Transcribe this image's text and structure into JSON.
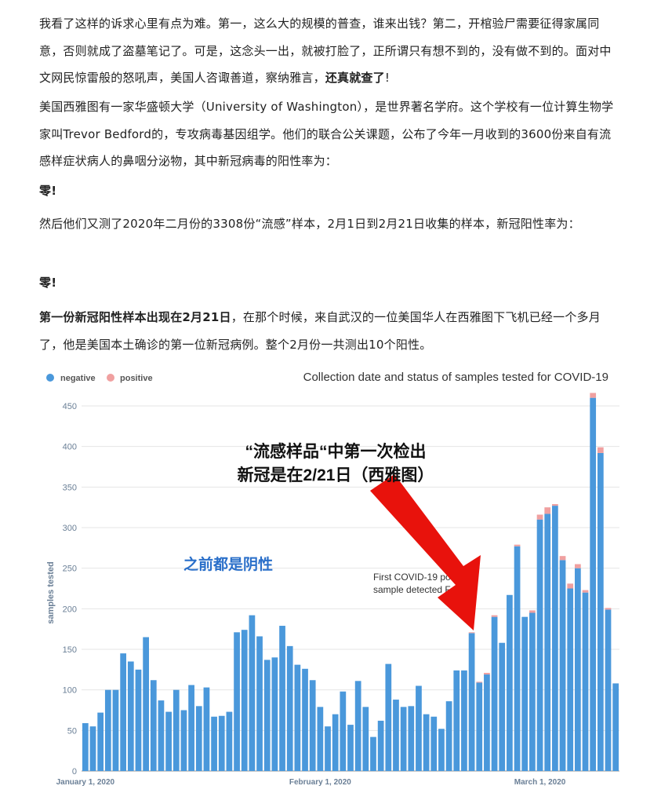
{
  "article": {
    "p1": "我看了这样的诉求心里有点为难。第一，这么大的规模的普查，谁来出钱？第二，开棺验尸需要征得家属同意，否则就成了盗墓笔记了。可是，这念头一出，就被打脸了，正所谓只有想不到的，没有做不到的。面对中文网民惊雷般的怒吼声，美国人咨诹善道，察纳雅言，",
    "p1_bold": "还真就查了",
    "p1_end": "!",
    "p2": "美国西雅图有一家华盛顿大学（University of Washington），是世界著名学府。这个学校有一位计算生物学家叫Trevor Bedford的，专攻病毒基因组学。他们的联合公关课题，公布了今年一月收到的3600份来自有流感样症状病人的鼻咽分泌物，其中新冠病毒的阳性率为：",
    "p3": "零!",
    "p4": "然后他们又测了2020年二月份的3308份“流感”样本，2月1日到2月21日收集的样本，新冠阳性率为：",
    "p5": "零!",
    "p6_bold": "第一份新冠阳性样本出现在2月21日",
    "p6": "，在那个时候，来自武汉的一位美国华人在西雅图下飞机已经一个多月了，他是美国本土确诊的第一位新冠病例。整个2月份一共测出10个阳性。"
  },
  "chart_data": {
    "type": "bar",
    "stacked": true,
    "title": "Collection date and status of samples tested for COVID-19",
    "ylabel": "samples tested",
    "xlabel": "",
    "ylim": [
      0,
      475
    ],
    "yticks": [
      0,
      50,
      100,
      150,
      200,
      250,
      300,
      350,
      400,
      450
    ],
    "grid": true,
    "legend": {
      "placement": "top-left",
      "items": [
        "negative",
        "positive"
      ]
    },
    "colors": {
      "negative": "#4a98db",
      "positive": "#f0a0a0",
      "annotation": "#2a6fc9",
      "arrow": "#e8120c"
    },
    "x_labels": [
      {
        "label": "January 1, 2020",
        "index": 0
      },
      {
        "label": "February 1, 2020",
        "index": 31
      },
      {
        "label": "March 1, 2020",
        "index": 60
      }
    ],
    "series": [
      {
        "name": "negative",
        "values": [
          59,
          55,
          72,
          100,
          100,
          145,
          135,
          125,
          165,
          112,
          87,
          73,
          100,
          75,
          106,
          80,
          103,
          67,
          68,
          73,
          171,
          174,
          192,
          166,
          137,
          140,
          179,
          154,
          131,
          126,
          112,
          79,
          55,
          70,
          98,
          57,
          111,
          79,
          42,
          62,
          132,
          88,
          79,
          80,
          105,
          70,
          67,
          52,
          86,
          124,
          124,
          170,
          109,
          119,
          190,
          158,
          217,
          277,
          190,
          195,
          310,
          317,
          327,
          260,
          225,
          250,
          220,
          460,
          392,
          199,
          108
        ]
      },
      {
        "name": "positive",
        "values": [
          0,
          0,
          0,
          0,
          0,
          0,
          0,
          0,
          0,
          0,
          0,
          0,
          0,
          0,
          0,
          0,
          0,
          0,
          0,
          0,
          0,
          0,
          0,
          0,
          0,
          0,
          0,
          0,
          0,
          0,
          0,
          0,
          0,
          0,
          0,
          0,
          0,
          0,
          0,
          0,
          0,
          0,
          0,
          0,
          0,
          0,
          0,
          0,
          0,
          0,
          0,
          1,
          1,
          2,
          2,
          0,
          0,
          2,
          0,
          3,
          6,
          8,
          2,
          5,
          6,
          5,
          3,
          6,
          7,
          2,
          0
        ]
      }
    ],
    "annotations": {
      "zh_title_line1": "“流感样品“中第一次检出",
      "zh_title_line2": "新冠是在2/21日（西雅图）",
      "zh_negative_note": "之前都是阴性",
      "en_note_line1": "First COVID-19 positive",
      "en_note_line2": "sample detected Feb 21"
    }
  }
}
